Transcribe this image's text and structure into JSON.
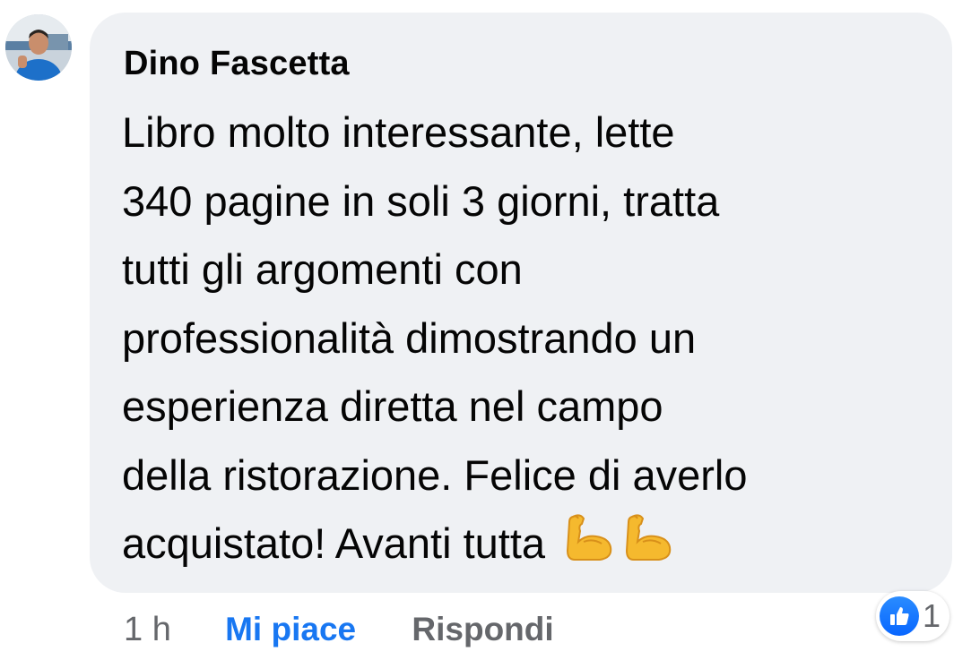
{
  "comment": {
    "author": "Dino Fascetta",
    "text_lines": [
      "Libro molto interessante, lette",
      "340 pagine in soli 3 giorni, tratta",
      "tutti gli argomenti con",
      "professionalità dimostrando un",
      "esperienza diretta nel campo",
      "della ristorazione. Felice di averlo",
      "acquistato! Avanti tutta"
    ],
    "trailing_emojis": [
      "flexed-biceps-icon",
      "flexed-biceps-icon"
    ]
  },
  "actions": {
    "time": "1 h",
    "like_label": "Mi piace",
    "reply_label": "Rispondi"
  },
  "reactions": {
    "icon": "thumbs-up-icon",
    "count": "1"
  },
  "colors": {
    "bubble": "#eff1f4",
    "text": "#050505",
    "muted": "#65676b",
    "like_blue": "#1877f2"
  }
}
